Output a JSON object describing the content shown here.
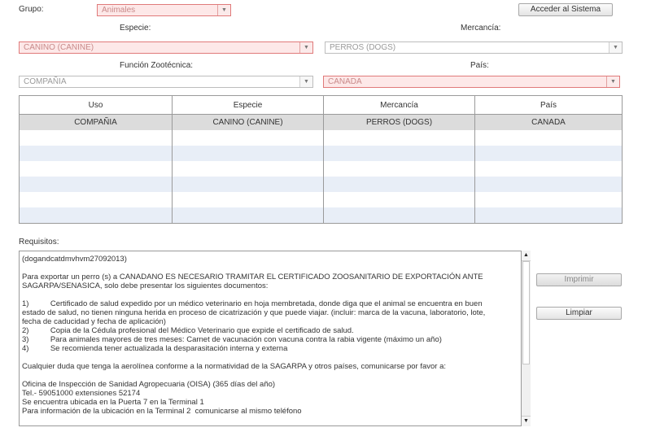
{
  "filters": {
    "grupo": {
      "label": "Grupo:",
      "value": "Animales"
    },
    "especie": {
      "label": "Especie:",
      "value": "CANINO (CANINE)"
    },
    "mercancia": {
      "label": "Mercancía:",
      "value": "PERROS (DOGS)"
    },
    "funcion": {
      "label": "Función Zootécnica:",
      "value": "COMPAÑIA"
    },
    "pais": {
      "label": "País:",
      "value": "CANADA"
    }
  },
  "header": {
    "login_button": "Acceder al Sistema"
  },
  "grid": {
    "columns": [
      "Uso",
      "Especie",
      "Mercancía",
      "País"
    ],
    "rows": [
      [
        "COMPAÑIA",
        "CANINO (CANINE)",
        "PERROS (DOGS)",
        "CANADA"
      ]
    ]
  },
  "requisitos": {
    "label": "Requisitos:",
    "text": "(dogandcatdmvhvm27092013)\n\nPara exportar un perro (s) a CANADANO ES NECESARIO TRAMITAR EL CERTIFICADO ZOOSANITARIO DE EXPORTACIÓN ANTE\nSAGARPA/SENASICA, solo debe presentar los siguientes documentos:\n\n1)          Certificado de salud expedido por un médico veterinario en hoja membretada, donde diga que el animal se encuentra en buen\nestado de salud, no tienen ninguna herida en proceso de cicatrización y que puede viajar. (incluir: marca de la vacuna, laboratorio, lote,\nfecha de caducidad y fecha de aplicación)\n2)          Copia de la Cédula profesional del Médico Veterinario que expide el certificado de salud.\n3)          Para animales mayores de tres meses: Carnet de vacunación con vacuna contra la rabia vigente (máximo un año)\n4)          Se recomienda tener actualizada la desparasitación interna y externa\n\nCualquier duda que tenga la aerolínea conforme a la normatividad de la SAGARPA y otros países, comunicarse por favor a:\n\nOficina de Inspección de Sanidad Agropecuaria (OISA) (365 días del año)\nTel.- 59051000 extensiones 52174\nSe encuentra ubicada en la Puerta 7 en la Terminal 1\nPara información de la ubicación en la Terminal 2  comunicarse al mismo teléfono"
  },
  "actions": {
    "print_button": "Imprimir",
    "clear_button": "Limpiar"
  },
  "icons": {
    "dropdown": "chevron-down-icon",
    "scroll_up": "arrow-up-icon",
    "scroll_down": "arrow-down-icon"
  },
  "colors": {
    "error_border": "#e07a7a",
    "error_fill": "#fde8e8",
    "alt_row": "#e8eef7",
    "selected_row": "#dcdcdc"
  }
}
